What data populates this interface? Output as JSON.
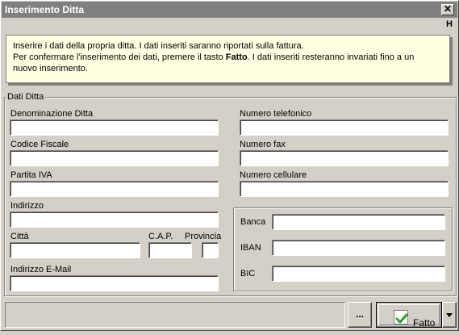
{
  "window": {
    "title": "Inserimento Ditta",
    "close_label": "✕",
    "help_label": "H"
  },
  "info": {
    "line1": "Inserire i dati della propria ditta. I dati inseriti saranno riportati sulla fattura.",
    "line2_before": "Per confermare l'inserimento dei dati, premere il tasto ",
    "line2_bold": "Fatto",
    "line2_after": ". I dati inseriti resteranno invariati fino a un",
    "line3": "nuovo inserimento."
  },
  "group": {
    "legend": "Dati Ditta"
  },
  "fields": {
    "denominazione": {
      "label": "Denominazione Ditta",
      "value": ""
    },
    "codice_fiscale": {
      "label": "Codice Fiscale",
      "value": ""
    },
    "partita_iva": {
      "label": "Partita IVA",
      "value": ""
    },
    "indirizzo": {
      "label": "Indirizzo",
      "value": ""
    },
    "citta": {
      "label": "Città",
      "value": ""
    },
    "cap": {
      "label": "C.A.P.",
      "value": ""
    },
    "provincia": {
      "label": "Provincia",
      "value": ""
    },
    "email": {
      "label": "Indirizzo E-Mail",
      "value": ""
    },
    "telefono": {
      "label": "Numero telefonico",
      "value": ""
    },
    "fax": {
      "label": "Numero fax",
      "value": ""
    },
    "cellulare": {
      "label": "Numero cellulare",
      "value": ""
    },
    "banca": {
      "label": "Banca",
      "value": ""
    },
    "iban": {
      "label": "IBAN",
      "value": ""
    },
    "bic": {
      "label": "BIC",
      "value": ""
    }
  },
  "footer": {
    "status_text": "",
    "dots_label": "...",
    "fatto_label": "Fatto"
  },
  "colors": {
    "accent_check": "#2a9d2a",
    "info_bg": "#ffffe1"
  },
  "icons": {
    "close": "close-icon",
    "check": "check-icon",
    "dropdown": "chevron-down-icon"
  }
}
